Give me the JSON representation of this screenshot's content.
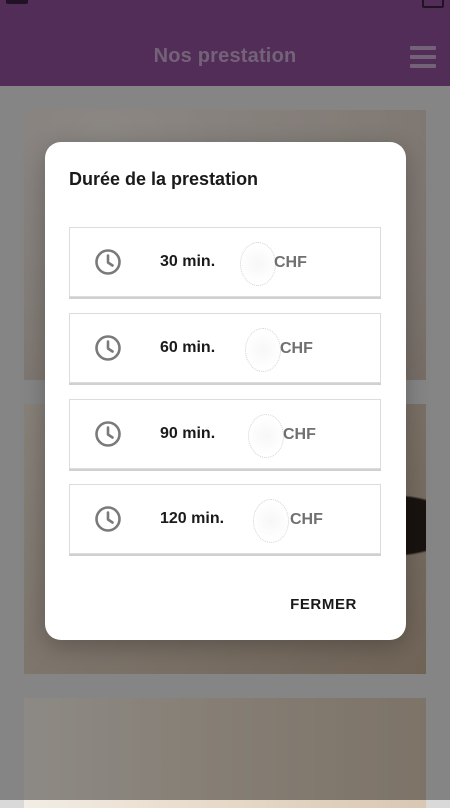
{
  "header": {
    "title": "Nos prestation"
  },
  "dialog": {
    "title": "Durée de la prestation",
    "options": [
      {
        "duration": "30 min.",
        "currency": "CHF"
      },
      {
        "duration": "60 min.",
        "currency": "CHF"
      },
      {
        "duration": "90 min.",
        "currency": "CHF"
      },
      {
        "duration": "120 min.",
        "currency": "CHF"
      }
    ],
    "close_label": "FERMER"
  },
  "icons": {
    "option": "clock-icon",
    "menu": "hamburger-menu-icon"
  },
  "colors": {
    "header": "#8e4f98",
    "header_text": "#c9a9cf",
    "dialog_bg": "#ffffff"
  }
}
